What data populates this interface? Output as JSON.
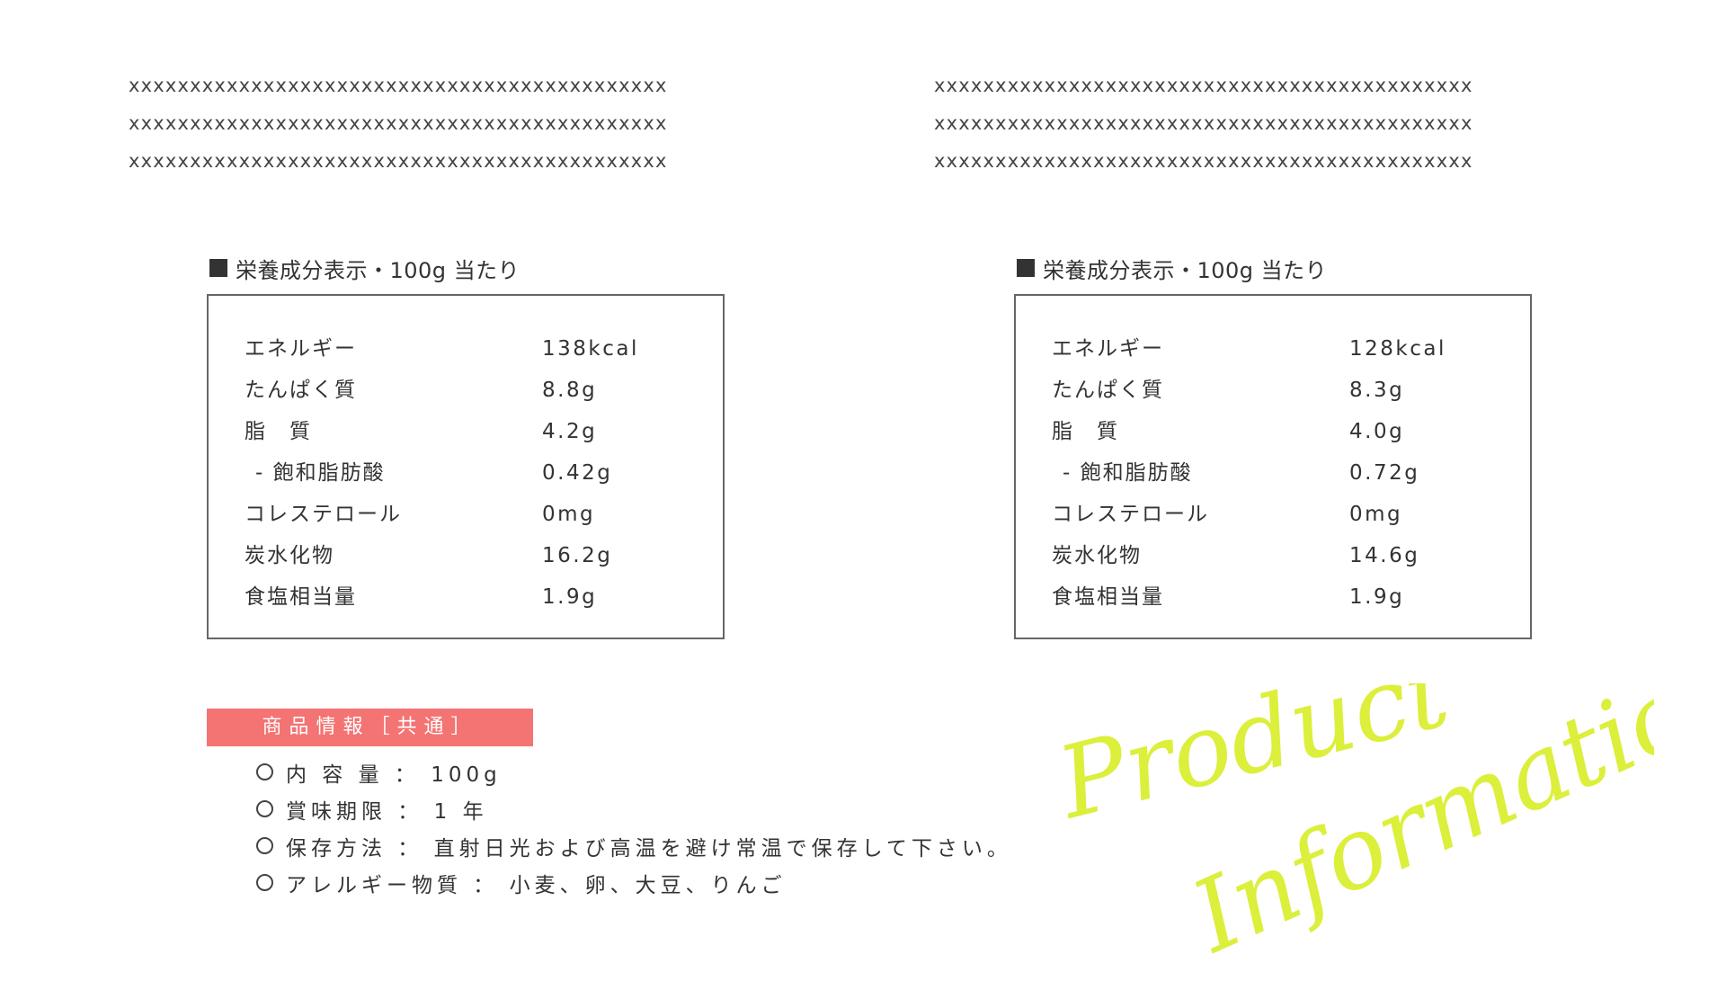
{
  "decorations": {
    "left_lines": [
      "xxxxxxxxxxxxxxxxxxxxxxxxxxxxxxxxxxxxxxxxxxxx",
      "xxxxxxxxxxxxxxxxxxxxxxxxxxxxxxxxxxxxxxxxxxxx",
      "xxxxxxxxxxxxxxxxxxxxxxxxxxxxxxxxxxxxxxxxxxxx"
    ],
    "right_lines": [
      "xxxxxxxxxxxxxxxxxxxxxxxxxxxxxxxxxxxxxxxxxxxx",
      "xxxxxxxxxxxxxxxxxxxxxxxxxxxxxxxxxxxxxxxxxxxx",
      "xxxxxxxxxxxxxxxxxxxxxxxxxxxxxxxxxxxxxxxxxxxx"
    ]
  },
  "nutrition_left": {
    "title": "栄養成分表示・100g 当たり",
    "rows": [
      {
        "label": "エネルギー",
        "value": "138kcal"
      },
      {
        "label": "たんぱく質",
        "value": "8.8g"
      },
      {
        "label": "脂　質",
        "value": "4.2g"
      },
      {
        "label": " - 飽和脂肪酸",
        "value": "0.42g"
      },
      {
        "label": "コレステロール",
        "value": "0mg"
      },
      {
        "label": "炭水化物",
        "value": "16.2g"
      },
      {
        "label": "食塩相当量",
        "value": "1.9g"
      }
    ]
  },
  "nutrition_right": {
    "title": "栄養成分表示・100g 当たり",
    "rows": [
      {
        "label": "エネルギー",
        "value": "128kcal"
      },
      {
        "label": "たんぱく質",
        "value": "8.3g"
      },
      {
        "label": "脂　質",
        "value": "4.0g"
      },
      {
        "label": " - 飽和脂肪酸",
        "value": "0.72g"
      },
      {
        "label": "コレステロール",
        "value": "0mg"
      },
      {
        "label": "炭水化物",
        "value": "14.6g"
      },
      {
        "label": "食塩相当量",
        "value": "1.9g"
      }
    ]
  },
  "product_info": {
    "band_label": "商品情報［共通］",
    "items": [
      "内 容 量 ： 100g",
      "賞味期限 ： 1 年",
      "保存方法 ： 直射日光および高温を避け常温で保存して下さい。",
      "アレルギー物質 ： 小麦、卵、大豆、りんご"
    ]
  },
  "brand": {
    "line1": "Product",
    "line2": "Information",
    "color": "#dbef3b"
  },
  "colors": {
    "band": "#f47373",
    "text": "#333333"
  }
}
